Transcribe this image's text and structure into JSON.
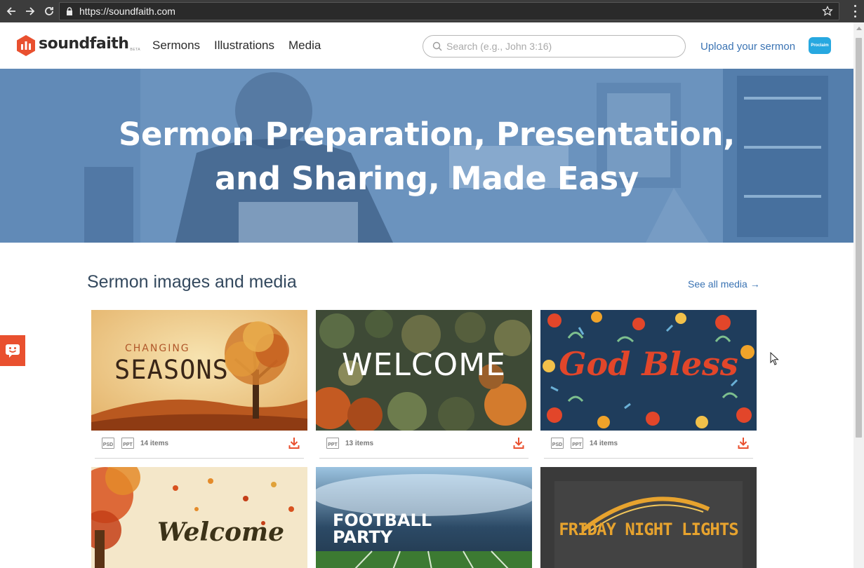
{
  "browser": {
    "url": "https://soundfaith.com"
  },
  "header": {
    "logo_text": "soundfaith",
    "logo_badge": "BETA",
    "nav": [
      "Sermons",
      "Illustrations",
      "Media"
    ],
    "search_placeholder": "Search (e.g., John 3:16)",
    "upload_label": "Upload your sermon",
    "proclaim_label": "Proclaim"
  },
  "hero": {
    "title_line1": "Sermon Preparation, Presentation,",
    "title_line2": "and Sharing, Made Easy"
  },
  "media_section": {
    "title": "Sermon images and media",
    "see_all": "See all media →",
    "cards": [
      {
        "art_title_small": "CHANGING",
        "art_title": "SEASONS",
        "formats": [
          "PSD",
          "PPT"
        ],
        "items": "14 items"
      },
      {
        "art_title": "WELCOME",
        "formats": [
          "PPT"
        ],
        "items": "13 items"
      },
      {
        "art_title": "God Bless",
        "formats": [
          "PSD",
          "PPT"
        ],
        "items": "14 items"
      },
      {
        "art_title": "Welcome"
      },
      {
        "art_title": "FOOTBALL",
        "art_title_line2": "PARTY"
      },
      {
        "art_title": "FRIDAY NIGHT LIGHTS"
      }
    ]
  },
  "colors": {
    "accent": "#e9502f",
    "link": "#3a73b3",
    "hero": "#6a94c0"
  }
}
